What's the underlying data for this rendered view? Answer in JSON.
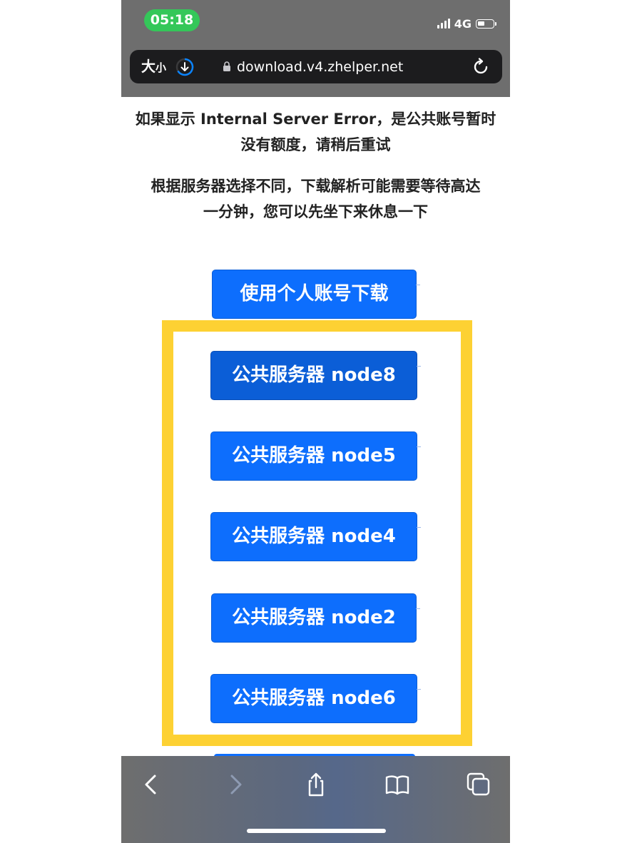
{
  "status_bar": {
    "time": "05:18",
    "network": "4G"
  },
  "browser": {
    "size_label_big": "大",
    "size_label_small": "小",
    "url": "download.v4.zhelper.net",
    "icons": {
      "download": "download-progress-icon",
      "lock": "lock-icon",
      "reload": "reload-icon"
    }
  },
  "content": {
    "message_1_line_1": "如果显示 Internal Server Error，是公共账号暂时",
    "message_1_line_2": "没有额度，请稍后重试",
    "message_2_line_1": "根据服务器选择不同，下载解析可能需要等待高达",
    "message_2_line_2": "一分钟，您可以先坐下来休息一下",
    "personal_download_label": "使用个人账号下载",
    "servers": [
      {
        "label": "公共服务器 node8"
      },
      {
        "label": "公共服务器 node5"
      },
      {
        "label": "公共服务器 node4"
      },
      {
        "label": "公共服务器 node2"
      },
      {
        "label": "公共服务器 node6"
      }
    ]
  },
  "toolbar": {
    "icons": [
      "back-icon",
      "forward-icon",
      "share-icon",
      "bookmarks-icon",
      "tabs-icon"
    ]
  },
  "colors": {
    "button_blue": "#0d6efd",
    "highlight_yellow": "#fdd133",
    "time_green": "#34c759"
  }
}
